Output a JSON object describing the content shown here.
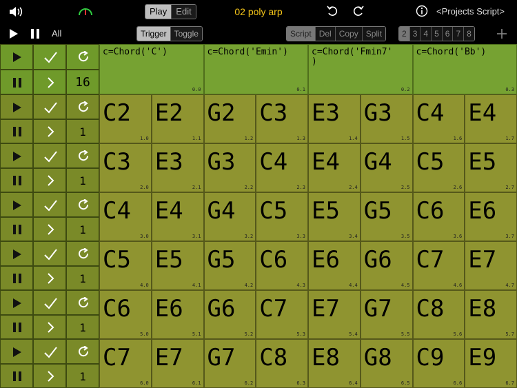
{
  "toolbar": {
    "title": "02 poly arp",
    "play_label": "Play",
    "edit_label": "Edit",
    "projects_label": "<Projects",
    "script_label": "Script>",
    "all_label": "All",
    "trigger_label": "Trigger",
    "toggle_label": "Toggle",
    "script_tab": "Script",
    "del_tab": "Del",
    "copy_tab": "Copy",
    "split_tab": "Split",
    "pages": [
      "2",
      "3",
      "4",
      "5",
      "6",
      "7",
      "8"
    ]
  },
  "head_row": {
    "count": "16",
    "cells": [
      {
        "text": "c=Chord('C')",
        "index": "0.0"
      },
      {
        "text": "c=Chord('Emin')",
        "index": "0.1"
      },
      {
        "text": "c=Chord('Fmin7'\n)",
        "index": "0.2"
      },
      {
        "text": "c=Chord('Bb')",
        "index": "0.3"
      }
    ]
  },
  "rows": [
    {
      "count": "1",
      "cells": [
        {
          "note": "C2",
          "index": "1.0"
        },
        {
          "note": "E2",
          "index": "1.1"
        },
        {
          "note": "G2",
          "index": "1.2"
        },
        {
          "note": "C3",
          "index": "1.3"
        },
        {
          "note": "E3",
          "index": "1.4"
        },
        {
          "note": "G3",
          "index": "1.5"
        },
        {
          "note": "C4",
          "index": "1.6"
        },
        {
          "note": "E4",
          "index": "1.7"
        }
      ]
    },
    {
      "count": "1",
      "cells": [
        {
          "note": "C3",
          "index": "2.0"
        },
        {
          "note": "E3",
          "index": "2.1"
        },
        {
          "note": "G3",
          "index": "2.2"
        },
        {
          "note": "C4",
          "index": "2.3"
        },
        {
          "note": "E4",
          "index": "2.4"
        },
        {
          "note": "G4",
          "index": "2.5"
        },
        {
          "note": "C5",
          "index": "2.6"
        },
        {
          "note": "E5",
          "index": "2.7"
        }
      ]
    },
    {
      "count": "1",
      "cells": [
        {
          "note": "C4",
          "index": "3.0"
        },
        {
          "note": "E4",
          "index": "3.1"
        },
        {
          "note": "G4",
          "index": "3.2"
        },
        {
          "note": "C5",
          "index": "3.3"
        },
        {
          "note": "E5",
          "index": "3.4"
        },
        {
          "note": "G5",
          "index": "3.5"
        },
        {
          "note": "C6",
          "index": "3.6"
        },
        {
          "note": "E6",
          "index": "3.7"
        }
      ]
    },
    {
      "count": "1",
      "cells": [
        {
          "note": "C5",
          "index": "4.0"
        },
        {
          "note": "E5",
          "index": "4.1"
        },
        {
          "note": "G5",
          "index": "4.2"
        },
        {
          "note": "C6",
          "index": "4.3"
        },
        {
          "note": "E6",
          "index": "4.4"
        },
        {
          "note": "G6",
          "index": "4.5"
        },
        {
          "note": "C7",
          "index": "4.6"
        },
        {
          "note": "E7",
          "index": "4.7"
        }
      ]
    },
    {
      "count": "1",
      "cells": [
        {
          "note": "C6",
          "index": "5.0"
        },
        {
          "note": "E6",
          "index": "5.1"
        },
        {
          "note": "G6",
          "index": "5.2"
        },
        {
          "note": "C7",
          "index": "5.3"
        },
        {
          "note": "E7",
          "index": "5.4"
        },
        {
          "note": "G7",
          "index": "5.5"
        },
        {
          "note": "C8",
          "index": "5.6"
        },
        {
          "note": "E8",
          "index": "5.7"
        }
      ]
    },
    {
      "count": "1",
      "cells": [
        {
          "note": "C7",
          "index": "6.0"
        },
        {
          "note": "E7",
          "index": "6.1"
        },
        {
          "note": "G7",
          "index": "6.2"
        },
        {
          "note": "C8",
          "index": "6.3"
        },
        {
          "note": "E8",
          "index": "6.4"
        },
        {
          "note": "G8",
          "index": "6.5"
        },
        {
          "note": "C9",
          "index": "6.6"
        },
        {
          "note": "E9",
          "index": "6.7"
        }
      ]
    }
  ],
  "icons": [
    "speaker-icon",
    "gauge-icon",
    "undo-icon",
    "redo-icon",
    "info-icon",
    "play-icon",
    "pause-icon",
    "check-icon",
    "chevron-right-icon",
    "repeat-icon",
    "plus-icon"
  ],
  "colors": {
    "accent": "#f5c518",
    "header_cell": "#76a232",
    "note_cell": "#8f9430",
    "control_cell": "#7a8a28"
  }
}
